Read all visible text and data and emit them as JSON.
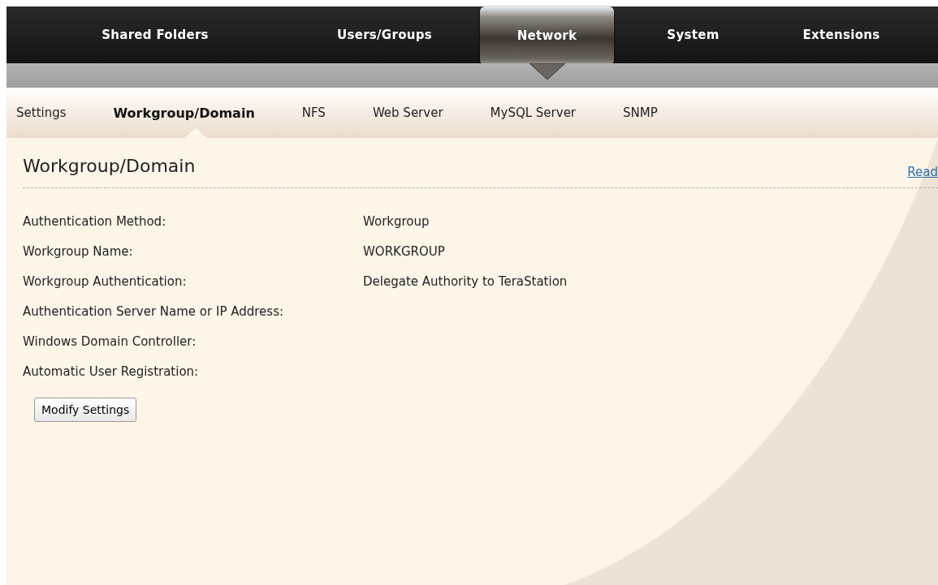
{
  "main_tabs": [
    {
      "label": "Shared Folders",
      "selected": false
    },
    {
      "label": "Users/Groups",
      "selected": false
    },
    {
      "label": "Network",
      "selected": true
    },
    {
      "label": "System",
      "selected": false
    },
    {
      "label": "Extensions",
      "selected": false
    }
  ],
  "sub_tabs": [
    {
      "label": "Settings",
      "selected": false
    },
    {
      "label": "Workgroup/Domain",
      "selected": true
    },
    {
      "label": "NFS",
      "selected": false
    },
    {
      "label": "Web Server",
      "selected": false
    },
    {
      "label": "MySQL Server",
      "selected": false
    },
    {
      "label": "SNMP",
      "selected": false
    }
  ],
  "page_title": "Workgroup/Domain",
  "help_link": "Read",
  "fields": [
    {
      "label": "Authentication Method:",
      "value": "Workgroup"
    },
    {
      "label": "Workgroup Name:",
      "value": "WORKGROUP"
    },
    {
      "label": "Workgroup Authentication:",
      "value": "Delegate Authority to TeraStation"
    },
    {
      "label": "Authentication Server Name or IP Address:"
    },
    {
      "label": "Windows Domain Controller:"
    },
    {
      "label": "Automatic User Registration:"
    }
  ],
  "button": "Modify Settings"
}
